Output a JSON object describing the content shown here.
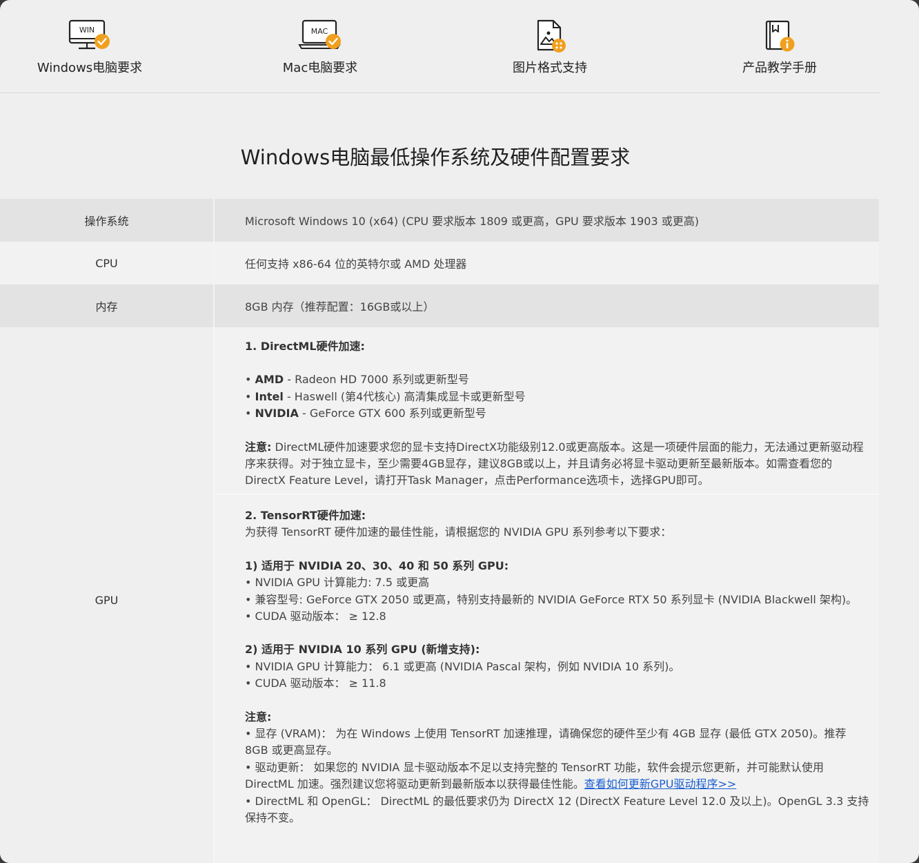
{
  "nav": {
    "items": [
      {
        "label": "Windows电脑要求",
        "badge_text": "WIN",
        "icon": "windows-monitor-check-icon"
      },
      {
        "label": "Mac电脑要求",
        "badge_text": "MAC",
        "icon": "mac-laptop-check-icon"
      },
      {
        "label": "图片格式支持",
        "icon": "image-file-icon"
      },
      {
        "label": "产品教学手册",
        "icon": "manual-book-info-icon"
      }
    ],
    "accent_color": "#f0a01e"
  },
  "page_title": "Windows电脑最低操作系统及硬件配置要求",
  "specs": {
    "os": {
      "label": "操作系统",
      "value": "Microsoft Windows 10 (x64) (CPU 要求版本 1809 或更高，GPU 要求版本 1903 或更高)"
    },
    "cpu": {
      "label": "CPU",
      "value": "任何支持 x86-64 位的英特尔或 AMD 处理器"
    },
    "memory": {
      "label": "内存",
      "value": "8GB 内存（推荐配置：16GB或以上）"
    },
    "gpu": {
      "label": "GPU",
      "directml": {
        "heading": "1. DirectML硬件加速:",
        "items": [
          {
            "brand": "AMD",
            "text": " - Radeon HD 7000 系列或更新型号"
          },
          {
            "brand": "Intel",
            "text": " - Haswell (第4代核心) 高清集成显卡或更新型号"
          },
          {
            "brand": "NVIDIA",
            "text": " - GeForce GTX 600 系列或更新型号"
          }
        ],
        "note_label": "注意:",
        "note_text": "  DirectML硬件加速要求您的显卡支持DirectX功能级别12.0或更高版本。这是一项硬件层面的能力，无法通过更新驱动程序来获得。对于独立显卡，至少需要4GB显存，建议8GB或以上，并且请务必将显卡驱动更新至最新版本。如需查看您的DirectX Feature Level，请打开Task Manager，点击Performance选项卡，选择GPU即可。"
      },
      "tensorrt": {
        "heading": "2. TensorRT硬件加速:",
        "intro": "为获得 TensorRT 硬件加速的最佳性能，请根据您的 NVIDIA GPU 系列参考以下要求：",
        "group1_heading": "1) 适用于 NVIDIA 20、30、40 和 50 系列 GPU:",
        "group1_items": [
          "• NVIDIA GPU 计算能力: 7.5 或更高",
          "• 兼容型号: GeForce GTX 2050 或更高，特别支持最新的 NVIDIA GeForce RTX 50 系列显卡 (NVIDIA Blackwell 架构)。",
          "• CUDA 驱动版本： ≥ 12.8"
        ],
        "group2_heading": "2) 适用于 NVIDIA 10 系列 GPU (新增支持):",
        "group2_items": [
          "• NVIDIA GPU 计算能力： 6.1 或更高 (NVIDIA Pascal 架构，例如 NVIDIA 10 系列)。",
          "• CUDA 驱动版本： ≥ 11.8"
        ],
        "note_heading": "注意:",
        "note_vram": "• 显存 (VRAM)： 为在 Windows 上使用 TensorRT 加速推理，请确保您的硬件至少有 4GB 显存 (最低 GTX 2050)。推荐 8GB 或更高显存。",
        "note_driver": "• 驱动更新： 如果您的 NVIDIA 显卡驱动版本不足以支持完整的 TensorRT 功能，软件会提示您更新，并可能默认使用 DirectML 加速。强烈建议您将驱动更新到最新版本以获得最佳性能。",
        "driver_link": "查看如何更新GPU驱动程序>>",
        "note_opengl": "• DirectML 和 OpenGL： DirectML 的最低要求仍为 DirectX 12 (DirectX Feature Level 12.0 及以上)。OpenGL 3.3 支持保持不变。"
      }
    }
  }
}
